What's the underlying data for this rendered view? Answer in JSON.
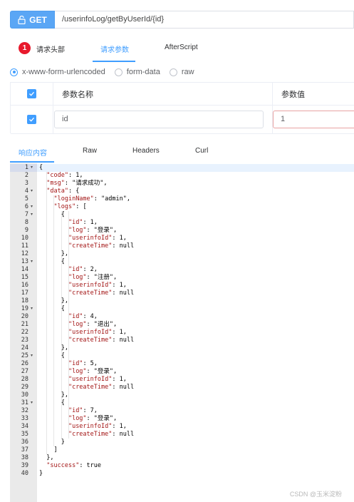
{
  "request": {
    "method": "GET",
    "url": "/userinfoLog/getByUserId/{id}"
  },
  "request_tabs": {
    "badge_count": "1",
    "headers_label": "请求头部",
    "params_label": "请求参数",
    "after_script_label": "AfterScript"
  },
  "body_types": {
    "urlencoded": "x-www-form-urlencoded",
    "form_data": "form-data",
    "raw": "raw",
    "selected": "x-www-form-urlencoded"
  },
  "params_table": {
    "headers": [
      "参数名称",
      "参数值"
    ],
    "rows": [
      {
        "checked": true,
        "name": "id",
        "value": "1"
      }
    ]
  },
  "response_tabs": {
    "body_label": "响应内容",
    "raw_label": "Raw",
    "headers_label": "Headers",
    "curl_label": "Curl"
  },
  "response": {
    "lines": [
      "{",
      "  \"code\": 1,",
      "  \"msg\": \"请求成功\",",
      "  \"data\": {",
      "    \"loginName\": \"admin\",",
      "    \"logs\": [",
      "      {",
      "        \"id\": 1,",
      "        \"log\": \"登录\",",
      "        \"userinfoId\": 1,",
      "        \"createTime\": null",
      "      },",
      "      {",
      "        \"id\": 2,",
      "        \"log\": \"注册\",",
      "        \"userinfoId\": 1,",
      "        \"createTime\": null",
      "      },",
      "      {",
      "        \"id\": 4,",
      "        \"log\": \"退出\",",
      "        \"userinfoId\": 1,",
      "        \"createTime\": null",
      "      },",
      "      {",
      "        \"id\": 5,",
      "        \"log\": \"登录\",",
      "        \"userinfoId\": 1,",
      "        \"createTime\": null",
      "      },",
      "      {",
      "        \"id\": 7,",
      "        \"log\": \"登录\",",
      "        \"userinfoId\": 1,",
      "        \"createTime\": null",
      "      }",
      "    ]",
      "  },",
      "  \"success\": true",
      "}"
    ],
    "fold_lines": [
      1,
      4,
      6,
      7,
      13,
      19,
      25,
      31
    ]
  },
  "watermark": "CSDN @玉米淀粉",
  "colors": {
    "accent": "#409eff",
    "method_bg": "#5aa6f5",
    "badge": "#e8192c",
    "json_key": "#a31515"
  }
}
